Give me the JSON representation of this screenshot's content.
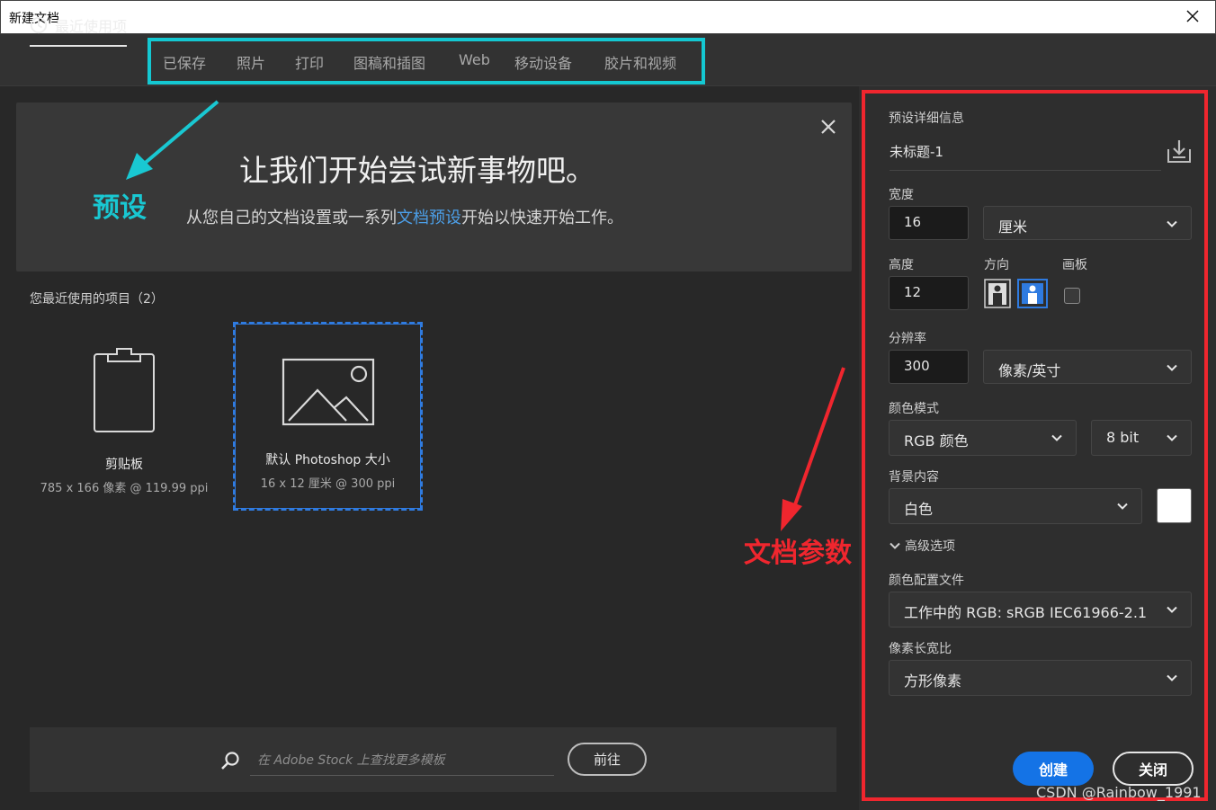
{
  "window": {
    "title": "新建文档"
  },
  "tabs": [
    {
      "label": "最近使用项",
      "active": true
    },
    {
      "label": "已保存"
    },
    {
      "label": "照片"
    },
    {
      "label": "打印"
    },
    {
      "label": "图稿和插图"
    },
    {
      "label": "Web"
    },
    {
      "label": "移动设备"
    },
    {
      "label": "胶片和视频"
    }
  ],
  "banner": {
    "title": "让我们开始尝试新事物吧。",
    "subtitle_before": "从您自己的文档设置或一系列",
    "subtitle_link": "文档预设",
    "subtitle_after": "开始以快速开始工作。"
  },
  "recent": {
    "heading": "您最近使用的项目（2）",
    "items": [
      {
        "name": "剪贴板",
        "meta": "785 x 166 像素 @ 119.99 ppi",
        "icon": "clipboard-icon",
        "selected": false
      },
      {
        "name": "默认 Photoshop 大小",
        "meta": "16 x 12 厘米 @ 300 ppi",
        "icon": "image-icon",
        "selected": true
      }
    ]
  },
  "stock": {
    "placeholder": "在 Adobe Stock 上查找更多模板",
    "go_label": "前往"
  },
  "details": {
    "section_title": "预设详细信息",
    "preset_name": "未标题-1",
    "width_label": "宽度",
    "width_value": "16",
    "width_unit": "厘米",
    "height_label": "高度",
    "height_value": "12",
    "orientation_label": "方向",
    "artboard_label": "画板",
    "resolution_label": "分辨率",
    "resolution_value": "300",
    "resolution_unit": "像素/英寸",
    "color_mode_label": "颜色模式",
    "color_mode_value": "RGB 颜色",
    "bit_depth_value": "8 bit",
    "background_label": "背景内容",
    "background_value": "白色",
    "advanced_label": "高级选项",
    "color_profile_label": "颜色配置文件",
    "color_profile_value": "工作中的 RGB: sRGB IEC61966-2.1",
    "pixel_aspect_label": "像素长宽比",
    "pixel_aspect_value": "方形像素",
    "create_label": "创建",
    "close_label": "关闭"
  },
  "annotations": {
    "preset": "预设",
    "doc_params": "文档参数",
    "annotation_cyan": "#14c8d2",
    "annotation_red": "#f0262e"
  },
  "watermark": "CSDN @Rainbow_1991",
  "colors": {
    "accent_blue": "#1473e6",
    "link_blue": "#4c9fe8"
  }
}
